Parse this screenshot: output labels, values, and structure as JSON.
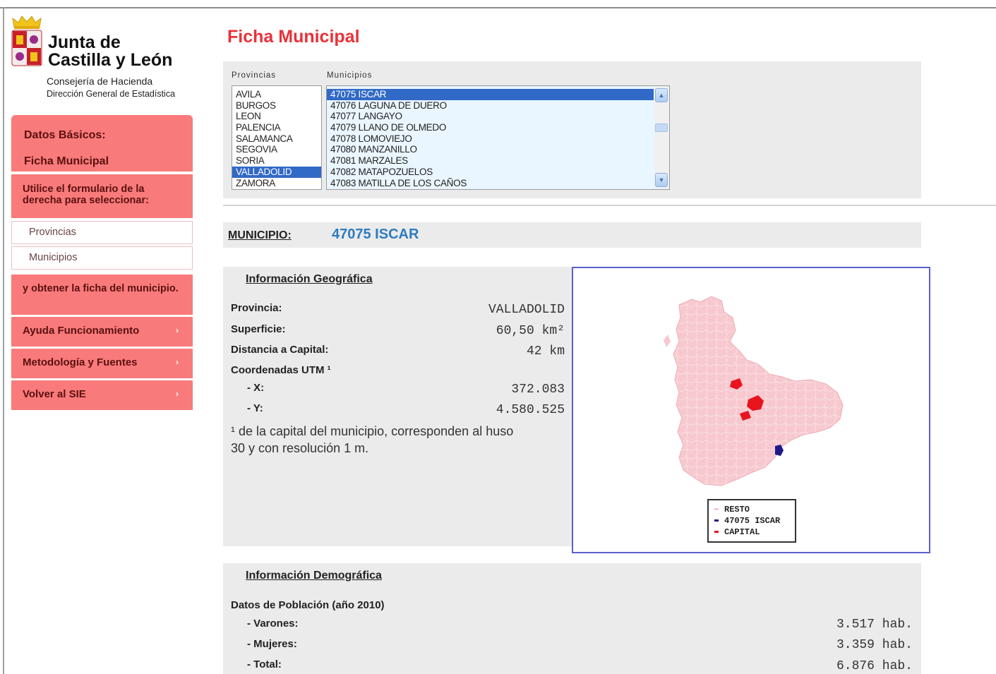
{
  "logo": {
    "title_line1": "Junta de",
    "title_line2": "Castilla y León",
    "consejeria": "Consejería de Hacienda",
    "direccion": "Dirección General de Estadística"
  },
  "sidebar": {
    "datos_basicos": "Datos Básicos:",
    "ficha_municipal": "Ficha Municipal",
    "instruction": "Utilice el formulario de la derecha para seleccionar:",
    "links": [
      "Provincias",
      "Municipios"
    ],
    "instruction2": "y obtener la ficha del municipio.",
    "nav": [
      "Ayuda Funcionamiento",
      "Metodología y Fuentes",
      "Volver al SIE"
    ],
    "nav_arrow": "›"
  },
  "page_title": "Ficha Municipal",
  "selector": {
    "provincias_label": "Provincias",
    "municipios_label": "Municipios",
    "provincias": [
      "AVILA",
      "BURGOS",
      "LEON",
      "PALENCIA",
      "SALAMANCA",
      "SEGOVIA",
      "SORIA",
      "VALLADOLID",
      "ZAMORA"
    ],
    "provincia_selected": "VALLADOLID",
    "municipios": [
      "47075 ISCAR",
      "47076 LAGUNA DE DUERO",
      "47077 LANGAYO",
      "47079 LLANO DE OLMEDO",
      "47078 LOMOVIEJO",
      "47080 MANZANILLO",
      "47081 MARZALES",
      "47082 MATAPOZUELOS",
      "47083 MATILLA DE LOS CAÑOS"
    ],
    "municipio_selected": "47075 ISCAR"
  },
  "municipio": {
    "label": "MUNICIPIO:",
    "value": "47075 ISCAR"
  },
  "geo": {
    "title": "Información Geográfica",
    "provincia_label": "Provincia:",
    "provincia_value": "VALLADOLID",
    "superficie_label": "Superficie:",
    "superficie_value": "60,50 km²",
    "distancia_label": "Distancia a Capital:",
    "distancia_value": "42 km",
    "coordenadas_label": "Coordenadas UTM ¹",
    "x_label": "- X:",
    "x_value": "372.083",
    "y_label": "- Y:",
    "y_value": "4.580.525",
    "note": "¹ de la capital del municipio, corresponden al huso 30 y con resolución 1 m."
  },
  "map": {
    "legend": [
      "RESTO",
      "47075 ISCAR",
      "CAPITAL"
    ],
    "colors": {
      "resto": "#f7c9cf",
      "municipio": "#1f1a8c",
      "capital": "#e8141e"
    }
  },
  "demo": {
    "title": "Información Demográfica",
    "poblacion_label": "Datos de Población (año 2010)",
    "varones_label": "- Varones:",
    "varones_value": "3.517 hab.",
    "mujeres_label": "- Mujeres:",
    "mujeres_value": "3.359 hab.",
    "total_label": "- Total:",
    "total_value": "6.876 hab."
  }
}
